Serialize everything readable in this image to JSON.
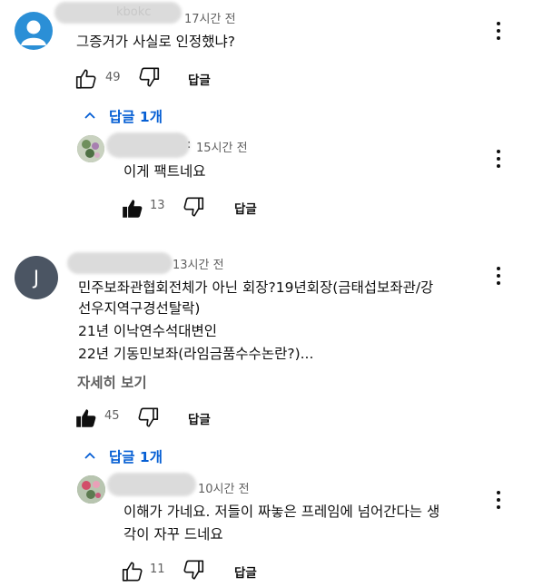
{
  "comment1": {
    "author_visible_fragment": "kbokc",
    "time": "17시간 전",
    "text": "그증거가 사실로 인정했냐?",
    "likes": "49",
    "reply_label": "답글",
    "replies_toggle": "답글 1개",
    "reply1": {
      "author_visible_fragment": ":",
      "time": "15시간 전",
      "text": "이게 팩트네요",
      "likes": "13",
      "reply_label": "답글"
    }
  },
  "comment2": {
    "avatar_letter": "J",
    "time": "13시간 전",
    "lines": [
      "민주보좌관협회전체가 아닌 회장?19년회장(금태섭보좌관/강",
      "선우지역구경선탈락)",
      "21년 이낙연수석대변인",
      "22년 기동민보좌(라임금품수수논란?)..."
    ],
    "read_more": "자세히 보기",
    "likes": "45",
    "reply_label": "답글",
    "replies_toggle": "답글 1개",
    "reply1": {
      "time": "10시간 전",
      "lines": [
        "이해가 가네요. 저들이  짜놓은 프레임에 넘어간다는 생",
        "각이 자꾸 드네요"
      ],
      "likes": "11",
      "reply_label": "답글"
    }
  },
  "colors": {
    "accent_blue": "#065fd4",
    "avatar_default": "#2b8fd6",
    "avatar_j": "#4b5563"
  }
}
